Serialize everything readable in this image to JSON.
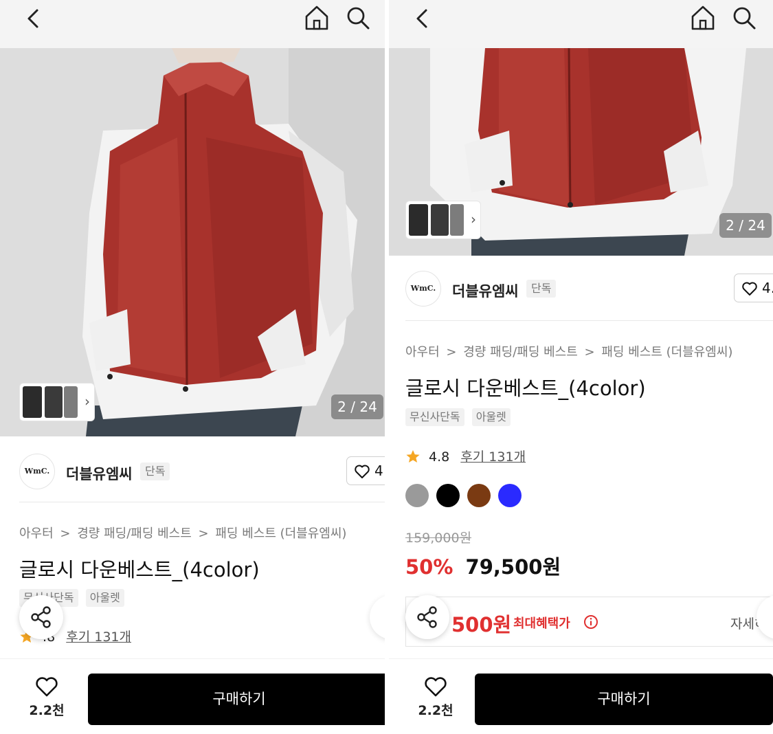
{
  "header": {
    "back_icon": "chevron-left-icon",
    "home_icon": "home-icon",
    "search_icon": "search-icon"
  },
  "product": {
    "image_counter": "2 / 24",
    "brand": {
      "logo_text": "WmC.",
      "name": "더블유엠씨",
      "badge": "단독"
    },
    "like_count_left": "4",
    "like_count_right": "4.",
    "breadcrumb": [
      "아우터",
      ">",
      "경량 패딩/패딩 베스트",
      ">",
      "패딩 베스트 (더블유엠씨)"
    ],
    "title": "글로시 다운베스트_(4color)",
    "tags_left": [
      "무신사단독",
      "아울렛"
    ],
    "tags_right": [
      "무신사단독",
      "아울렛"
    ],
    "rating": "4.8",
    "rating_left_partial": ".8",
    "reviews": "후기 131개",
    "colors": [
      "#9a9a9a",
      "#000000",
      "#7a3a12",
      "#2a2aff"
    ],
    "original_price": "159,000원",
    "discount": "50%",
    "sale_price": "79,500원",
    "benefit_price": "500원",
    "benefit_label": "최대혜택가",
    "benefit_detail": "자세히"
  },
  "bottom_bar": {
    "wish_count": "2.2천",
    "buy_label": "구매하기"
  },
  "colors": {
    "accent_red": "#e03030",
    "buy_button": "#000000",
    "vest": "#a8322c"
  }
}
